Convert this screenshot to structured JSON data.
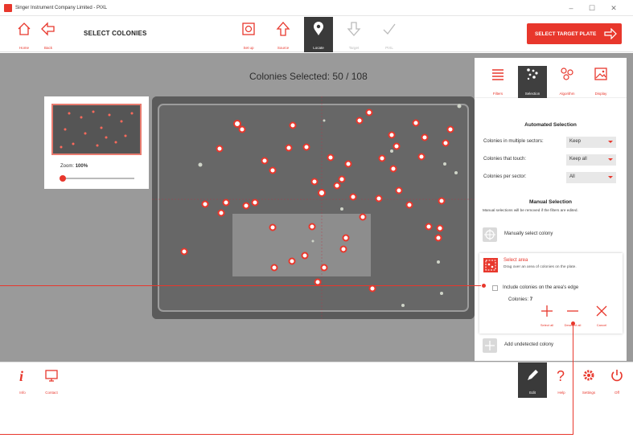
{
  "window": {
    "title": "Singer Instrument Company Limited - PIXL",
    "min": "–",
    "max": "☐",
    "close": "✕"
  },
  "toolbar": {
    "home": "Home",
    "back": "Back",
    "page_title": "SELECT COLONIES",
    "setup": "Set up",
    "source": "Source",
    "locate": "Locate",
    "target": "Target",
    "pixl": "PIXL",
    "select_target": "SELECT TARGET PLATE"
  },
  "workspace": {
    "selected_text": "Colonies Selected: 50 / 108",
    "zoom_label": "Zoom:",
    "zoom_value": "100%"
  },
  "panel": {
    "tabs": [
      "Filters",
      "Selection",
      "Algorithm",
      "Display"
    ],
    "automated_title": "Automated Selection",
    "rows": [
      {
        "label": "Colonies in multiple sectors:",
        "value": "Keep"
      },
      {
        "label": "Colonies that touch:",
        "value": "Keep all"
      },
      {
        "label": "Colonies per sector:",
        "value": "All"
      }
    ],
    "manual_title": "Manual Selection",
    "manual_note": "Manual selections will be removed if the filters are edited.",
    "manually_select": "Manually select colony",
    "select_area_title": "Select area",
    "select_area_sub": "Drag over an area of colonies on the plate.",
    "include_edge": "Include colonies on the area's edge",
    "colonies_label": "Colonies:",
    "colonies_value": "7",
    "select_all": "Select all",
    "deselect_all": "Deselect all",
    "cancel": "Cancel",
    "add_undetected": "Add undetected colony"
  },
  "bottombar": {
    "info": "Info",
    "contact": "Contact",
    "edit": "Edit",
    "help": "Help",
    "settings": "Settings",
    "off": "Off"
  },
  "colors": {
    "accent": "#e8372c",
    "dark": "#3a3a3a",
    "workspace": "#9a9a9a"
  }
}
